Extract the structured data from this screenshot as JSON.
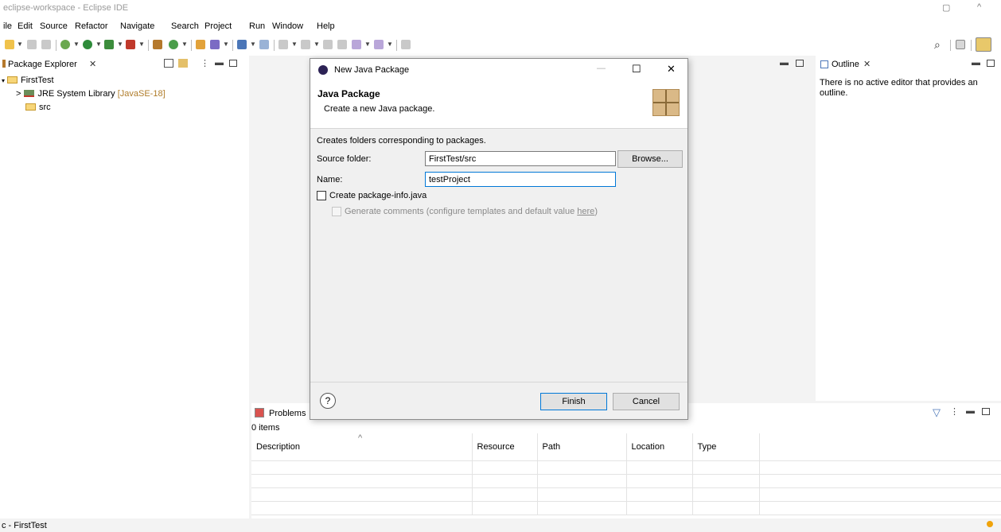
{
  "window": {
    "title": "eclipse-workspace - Eclipse IDE",
    "restore_glyph": "▢",
    "caret_glyph": "^"
  },
  "menu": [
    "ile",
    "Edit",
    "Source",
    "Refactor",
    "Navigate",
    "Search",
    "Project",
    "Run",
    "Window",
    "Help"
  ],
  "package_explorer": {
    "tab_label": "Package Explorer",
    "close_glyph": "✕",
    "items": [
      {
        "label": "FirstTest",
        "prefix": "▾"
      },
      {
        "label": "JRE System Library",
        "suffix": "[JavaSE-18]",
        "prefix": ">"
      },
      {
        "label": "src"
      }
    ]
  },
  "outline": {
    "tab_label": "Outline",
    "message": "There is no active editor that provides an outline."
  },
  "problems": {
    "tab_label": "Problems",
    "count": "0 items",
    "columns": [
      "Description",
      "Resource",
      "Path",
      "Location",
      "Type"
    ],
    "sort_glyph": "^"
  },
  "dialog": {
    "title": "New Java Package",
    "heading": "Java Package",
    "subheading": "Create a new Java package.",
    "description": "Creates folders corresponding to packages.",
    "source_folder_label": "Source folder:",
    "source_folder_value": "FirstTest/src",
    "browse_label": "Browse...",
    "name_label": "Name:",
    "name_value": "testProject",
    "create_package_info_label": "Create package-info.java",
    "generate_comments_label": "Generate comments (configure templates and default value ",
    "here_link": "here",
    "generate_comments_close": ")",
    "finish_label": "Finish",
    "cancel_label": "Cancel",
    "help_glyph": "?",
    "minimize_glyph": "—",
    "maximize_glyph": "☐",
    "close_glyph": "✕"
  },
  "status": {
    "text": "c - FirstTest"
  },
  "colors": {
    "accent": "#0078d7",
    "library_suffix": "#b07d2b"
  }
}
